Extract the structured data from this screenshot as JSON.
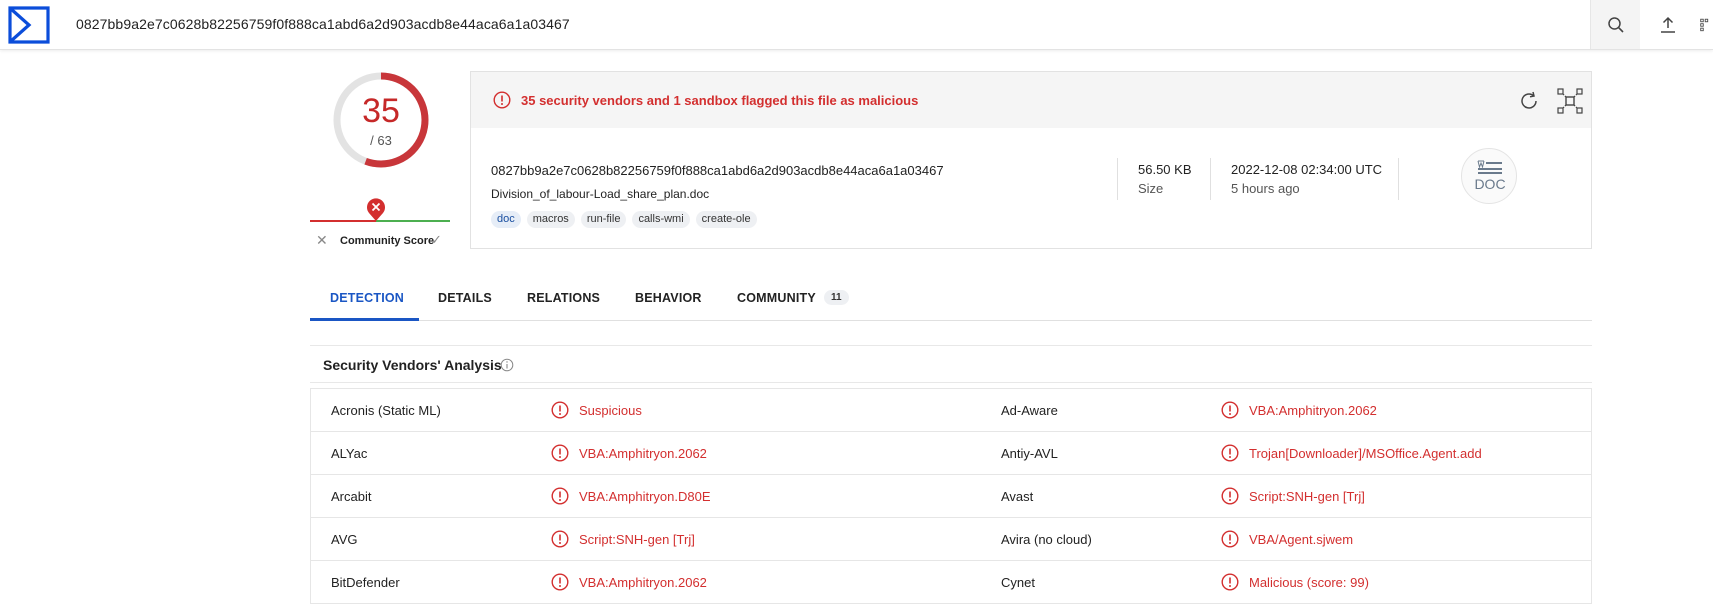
{
  "search": {
    "query": "0827bb9a2e7c0628b82256759f0f888ca1abd6a2d903acdb8e44aca6a1a03467"
  },
  "score": {
    "detections": "35",
    "total": "/ 63",
    "ring_fraction": 0.556
  },
  "community": {
    "label": "Community Score"
  },
  "alert": {
    "text": "35 security vendors and 1 sandbox flagged this file as malicious"
  },
  "file": {
    "hash": "0827bb9a2e7c0628b82256759f0f888ca1abd6a2d903acdb8e44aca6a1a03467",
    "name": "Division_of_labour-Load_share_plan.doc",
    "tags": [
      "doc",
      "macros",
      "run-file",
      "calls-wmi",
      "create-ole"
    ],
    "size_value": "56.50 KB",
    "size_label": "Size",
    "date": "2022-12-08 02:34:00 UTC",
    "date_ago": "5 hours ago",
    "type_icon_label": "DOC"
  },
  "tabs": [
    {
      "label": "DETECTION"
    },
    {
      "label": "DETAILS"
    },
    {
      "label": "RELATIONS"
    },
    {
      "label": "BEHAVIOR"
    },
    {
      "label": "COMMUNITY"
    }
  ],
  "community_badge": "11",
  "section": {
    "title": "Security Vendors' Analysis"
  },
  "vendors": [
    {
      "left_name": "Acronis (Static ML)",
      "left_result": "Suspicious",
      "right_name": "Ad-Aware",
      "right_result": "VBA:Amphitryon.2062"
    },
    {
      "left_name": "ALYac",
      "left_result": "VBA:Amphitryon.2062",
      "right_name": "Antiy-AVL",
      "right_result": "Trojan[Downloader]/MSOffice.Agent.add"
    },
    {
      "left_name": "Arcabit",
      "left_result": "VBA:Amphitryon.D80E",
      "right_name": "Avast",
      "right_result": "Script:SNH-gen [Trj]"
    },
    {
      "left_name": "AVG",
      "left_result": "Script:SNH-gen [Trj]",
      "right_name": "Avira (no cloud)",
      "right_result": "VBA/Agent.sjwem"
    },
    {
      "left_name": "BitDefender",
      "left_result": "VBA:Amphitryon.2062",
      "right_name": "Cynet",
      "right_result": "Malicious (score: 99)"
    }
  ],
  "colors": {
    "malicious": "#d32f2f",
    "accent": "#1a56c4",
    "brand": "#0b4dda"
  },
  "icons": [
    "virustotal-logo",
    "search-icon",
    "upload-icon",
    "apps-grid-icon",
    "alert-circle-icon",
    "reanalyze-icon",
    "graph-icon",
    "doc-file-icon",
    "info-icon"
  ]
}
